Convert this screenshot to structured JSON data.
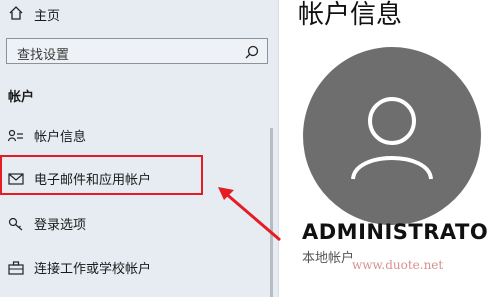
{
  "sidebar": {
    "home_label": "主页",
    "search_placeholder": "查找设置",
    "section_title": "帐户",
    "items": [
      {
        "label": "帐户信息",
        "icon": "person-list-icon"
      },
      {
        "label": "电子邮件和应用帐户",
        "icon": "mail-icon"
      },
      {
        "label": "登录选项",
        "icon": "key-icon"
      },
      {
        "label": "连接工作或学校帐户",
        "icon": "briefcase-icon"
      }
    ]
  },
  "main": {
    "title": "帐户信息",
    "username": "ADMINISTRATOR",
    "role": "本地帐户"
  },
  "watermark": "www.duote.net",
  "colors": {
    "sidebar_bg": "#e6ecf2",
    "highlight": "#e51c23",
    "avatar_bg": "#6e6e6e"
  }
}
